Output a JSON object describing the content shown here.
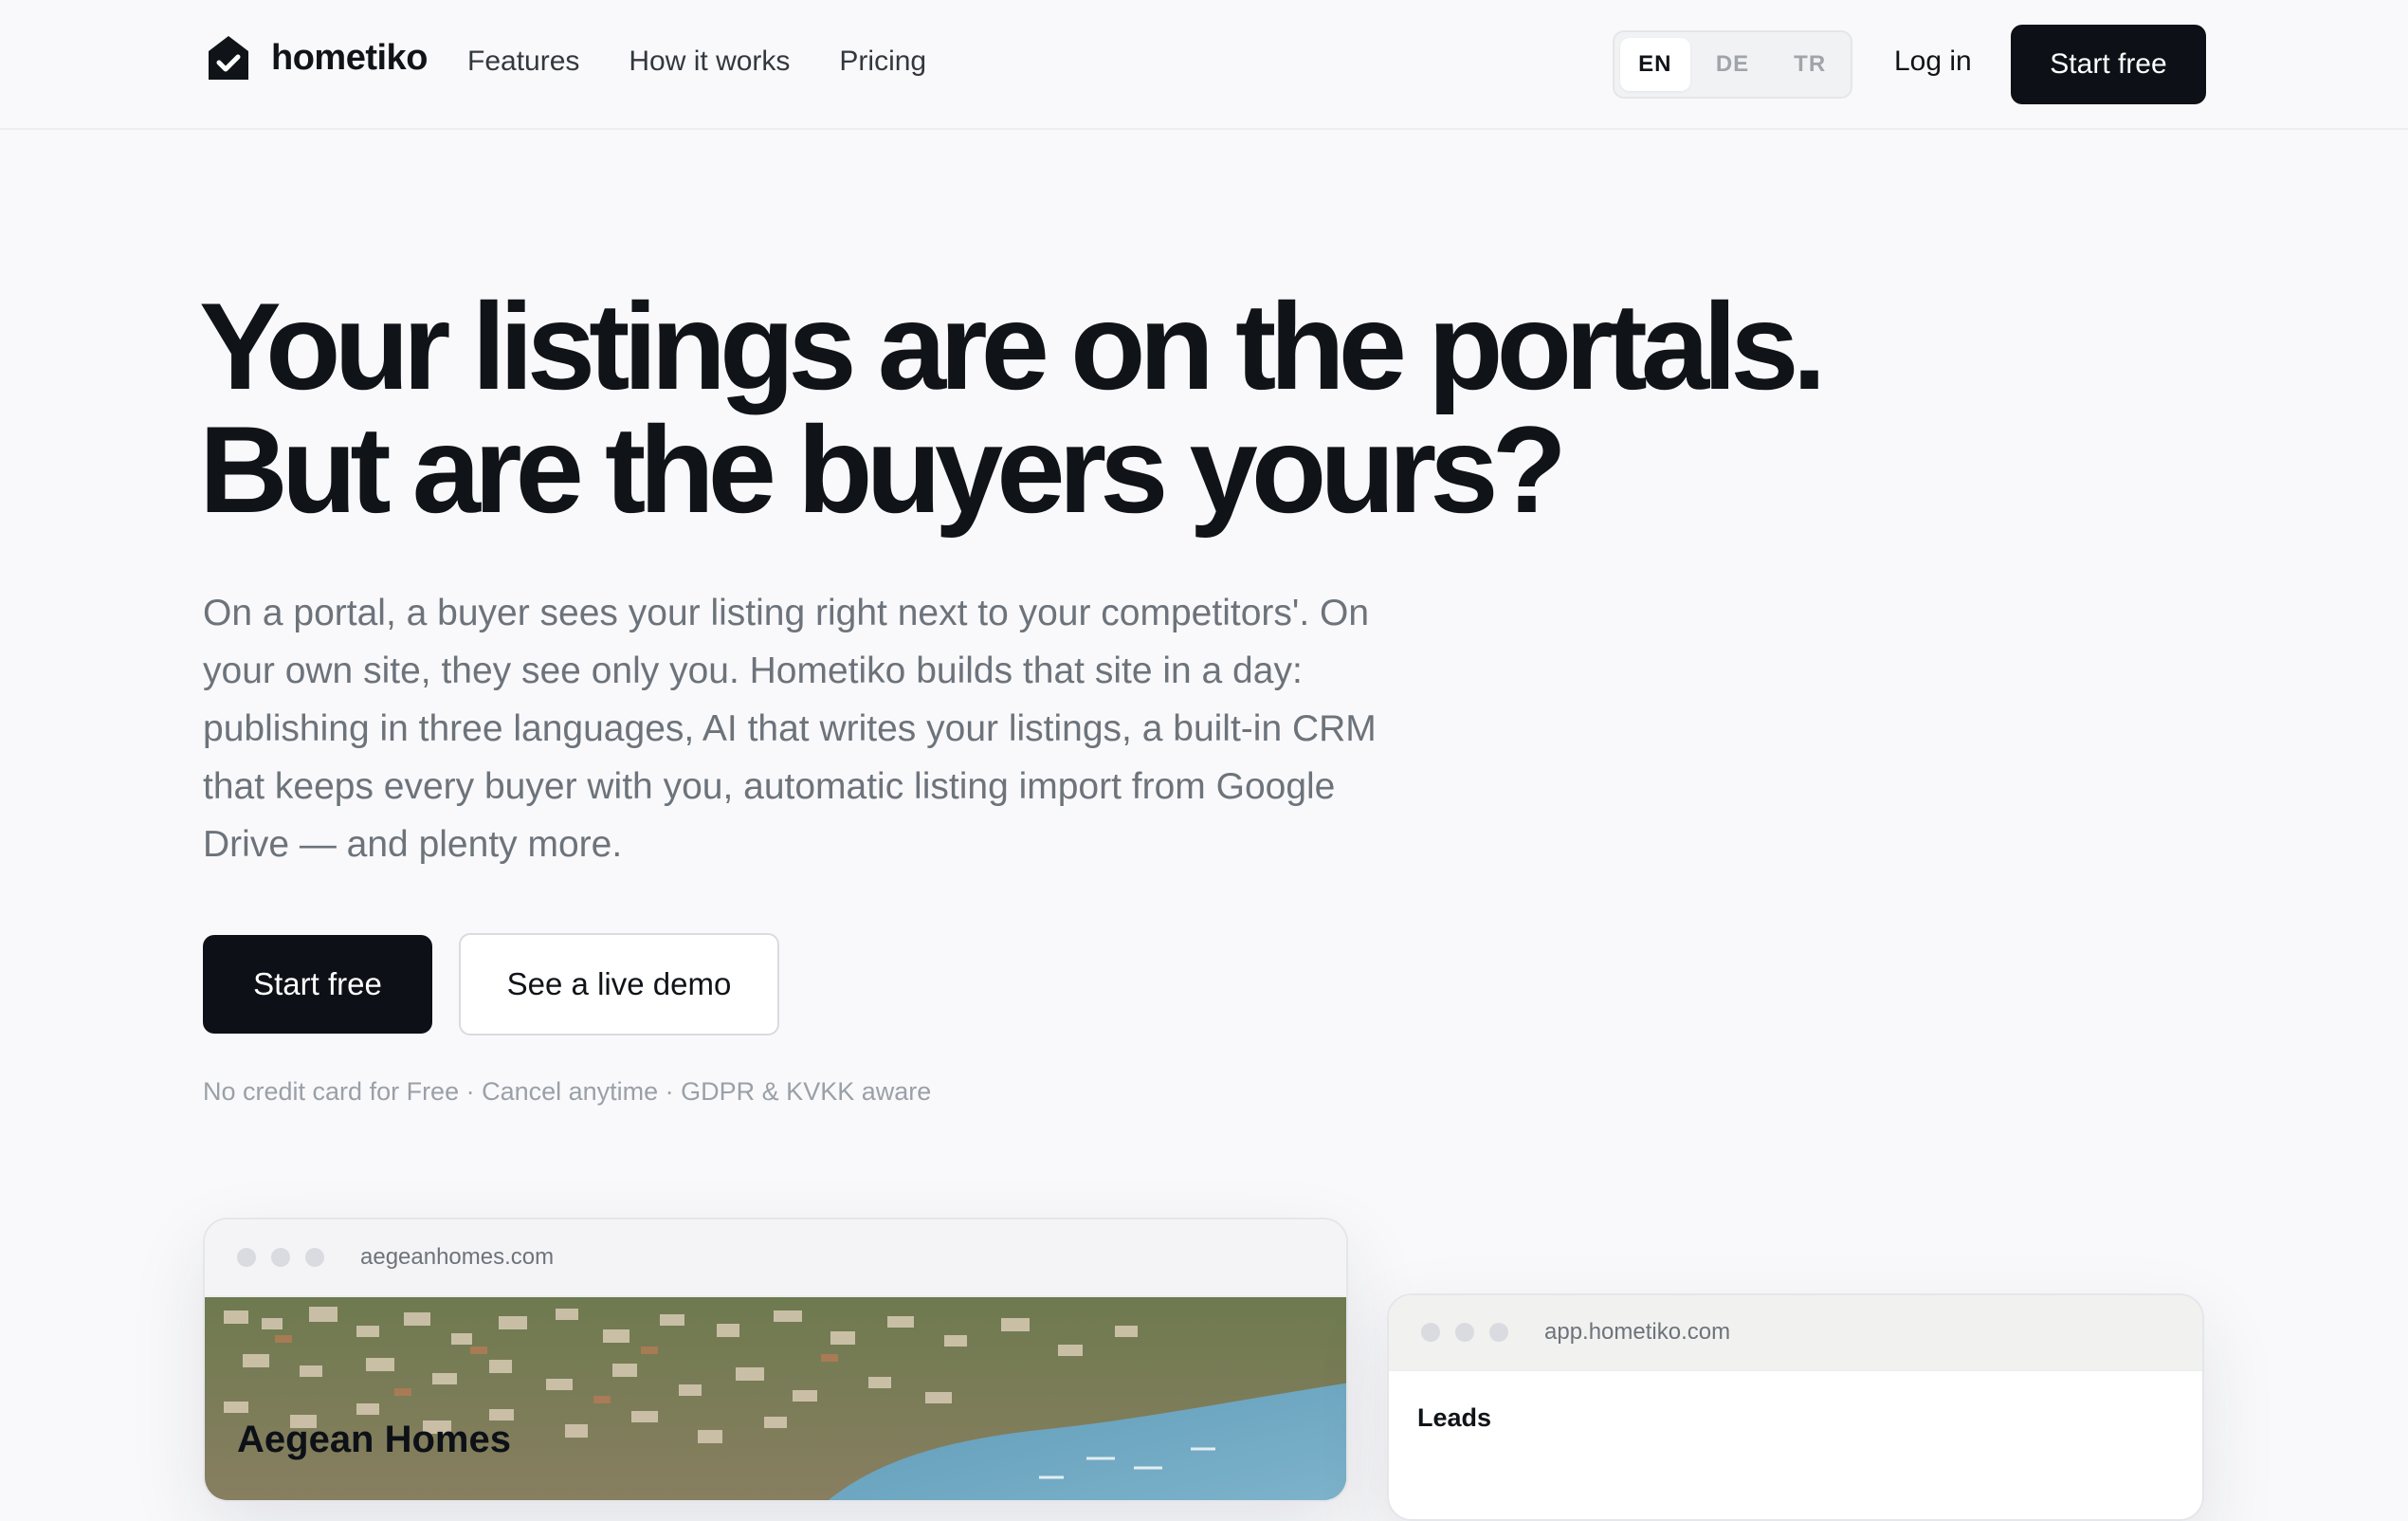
{
  "brand": {
    "name": "hometiko",
    "logo_icon": "house-check-icon"
  },
  "nav": {
    "items": [
      "Features",
      "How it works",
      "Pricing"
    ]
  },
  "language": {
    "options": [
      "EN",
      "DE",
      "TR"
    ],
    "selected": "EN"
  },
  "header": {
    "login_label": "Log in",
    "cta_label": "Start free"
  },
  "hero": {
    "headline_line1": "Your listings are on the portals.",
    "headline_line2": "But are the buyers yours?",
    "subtext": "On a portal, a buyer sees your listing right next to your competitors'. On your own site, they see only you. Hometiko builds that site in a day: publishing in three languages, AI that writes your listings, a built-in CRM that keeps every buyer with you, automatic listing import from Google Drive — and plenty more.",
    "primary_cta": "Start free",
    "secondary_cta": "See a live demo",
    "trust_line": "No credit card for Free · Cancel anytime · GDPR & KVKK aware"
  },
  "preview_site": {
    "url": "aegeanhomes.com",
    "title": "Aegean Homes"
  },
  "preview_app": {
    "url": "app.hometiko.com",
    "heading": "Leads"
  },
  "colors": {
    "background": "#f9f9fb",
    "primary": "#0d1117",
    "muted_text": "#6d737b",
    "border": "#e4e6ea"
  }
}
